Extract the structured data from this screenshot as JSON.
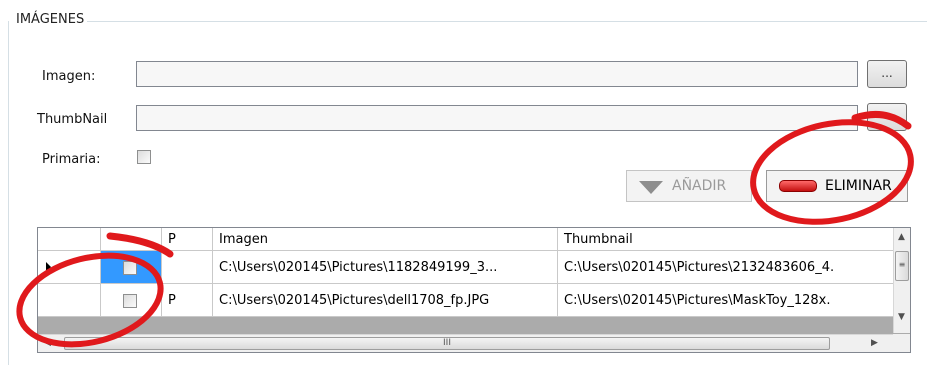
{
  "group": {
    "title": "IMÁGENES"
  },
  "form": {
    "imagen_label": "Imagen:",
    "imagen_value": "",
    "thumbnail_label": "ThumbNail",
    "thumbnail_value": "",
    "primaria_label": "Primaria:",
    "primaria_checked": false,
    "browse_label": "...",
    "thumbnail_browse_label": ""
  },
  "buttons": {
    "add_label": "AÑADIR",
    "add_enabled": false,
    "delete_label": "ELIMINAR"
  },
  "grid": {
    "columns": [
      "",
      "P",
      "Imagen",
      "Thumbnail"
    ],
    "rows": [
      {
        "selected": true,
        "checked": false,
        "p": "",
        "imagen": "C:\\Users\\020145\\Pictures\\1182849199_3...",
        "thumbnail": "C:\\Users\\020145\\Pictures\\2132483606_4."
      },
      {
        "selected": false,
        "checked": false,
        "p": "P",
        "imagen": "C:\\Users\\020145\\Pictures\\dell1708_fp.JPG",
        "thumbnail": "C:\\Users\\020145\\Pictures\\MaskToy_128x."
      }
    ],
    "scroll_thumb_grip": "III"
  },
  "colors": {
    "annotation": "#e0191c",
    "selection": "#3399ff"
  }
}
